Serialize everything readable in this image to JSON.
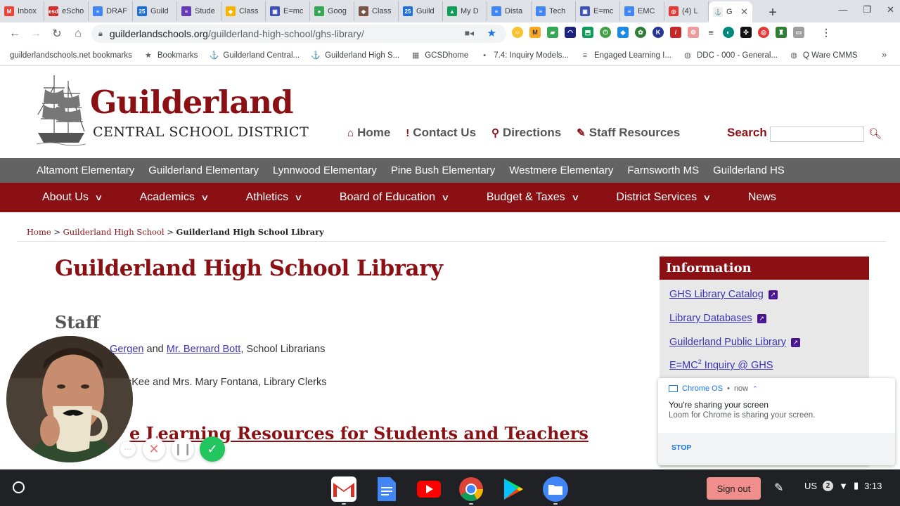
{
  "tabs": [
    {
      "label": "Inbox",
      "fav": "M",
      "color": "#ea4335",
      "icon": "gmail-icon"
    },
    {
      "label": "eScho",
      "fav": "esd",
      "color": "#d32f2f",
      "icon": "eschool-icon"
    },
    {
      "label": "DRAF",
      "fav": "≡",
      "color": "#4285f4",
      "icon": "docs-icon"
    },
    {
      "label": "Guild",
      "fav": "25",
      "color": "#1e6fd9",
      "icon": "calendar-icon"
    },
    {
      "label": "Stude",
      "fav": "≡",
      "color": "#673ab7",
      "icon": "forms-icon"
    },
    {
      "label": "Class",
      "fav": "◆",
      "color": "#f4b400",
      "icon": "classroom-icon"
    },
    {
      "label": "E=mc",
      "fav": "▣",
      "color": "#3f51b5",
      "icon": "site-icon"
    },
    {
      "label": "Goog",
      "fav": "●",
      "color": "#34a853",
      "icon": "hangouts-icon"
    },
    {
      "label": "Class",
      "fav": "◆",
      "color": "#795548",
      "icon": "classroom-icon"
    },
    {
      "label": "Guild",
      "fav": "25",
      "color": "#1e6fd9",
      "icon": "calendar-icon"
    },
    {
      "label": "My D",
      "fav": "▲",
      "color": "#0f9d58",
      "icon": "drive-icon"
    },
    {
      "label": "Dista",
      "fav": "≡",
      "color": "#4285f4",
      "icon": "docs-icon"
    },
    {
      "label": "Tech",
      "fav": "≡",
      "color": "#4285f4",
      "icon": "docs-icon"
    },
    {
      "label": "E=mc",
      "fav": "▣",
      "color": "#3f51b5",
      "icon": "site-icon"
    },
    {
      "label": "EMC",
      "fav": "≡",
      "color": "#4285f4",
      "icon": "docs-icon"
    },
    {
      "label": "(4) L",
      "fav": "◎",
      "color": "#e53935",
      "icon": "loom-icon"
    }
  ],
  "active_tab": {
    "label": "G",
    "icon": "guilderland-icon"
  },
  "address": {
    "host": "guilderlandschools.org",
    "path": "/guilderland-high-school/ghs-library/"
  },
  "bookmarks": [
    {
      "label": "guilderlandschools.net bookmarks",
      "icon": "folder-icon",
      "glyph": ""
    },
    {
      "label": "Bookmarks",
      "icon": "star-icon",
      "glyph": "★"
    },
    {
      "label": "Guilderland Central...",
      "icon": "guilderland-icon",
      "glyph": "⚓"
    },
    {
      "label": "Guilderland High S...",
      "icon": "guilderland-icon",
      "glyph": "⚓"
    },
    {
      "label": "GCSDhome",
      "icon": "grid-icon",
      "glyph": "▦"
    },
    {
      "label": "7.4: Inquiry Models...",
      "icon": "page-icon",
      "glyph": "▪"
    },
    {
      "label": "Engaged Learning I...",
      "icon": "docs-icon",
      "glyph": "≡"
    },
    {
      "label": "DDC - 000 - General...",
      "icon": "globe-icon",
      "glyph": "◍"
    },
    {
      "label": "Q Ware CMMS",
      "icon": "globe-icon",
      "glyph": "◍"
    }
  ],
  "site": {
    "title": "Guilderland",
    "subtitle": "CENTRAL SCHOOL DISTRICT",
    "topnav": [
      {
        "label": "Home",
        "icon": "home-icon",
        "glyph": "⌂"
      },
      {
        "label": "Contact Us",
        "icon": "info-icon",
        "glyph": "!"
      },
      {
        "label": "Directions",
        "icon": "map-pin-icon",
        "glyph": "⚲"
      },
      {
        "label": "Staff Resources",
        "icon": "paperclip-icon",
        "glyph": "✎"
      }
    ],
    "search_label": "Search",
    "schools": [
      "Altamont Elementary",
      "Guilderland Elementary",
      "Lynnwood Elementary",
      "Pine Bush Elementary",
      "Westmere Elementary",
      "Farnsworth MS",
      "Guilderland HS"
    ],
    "mainnav": [
      {
        "label": "About Us",
        "dropdown": true
      },
      {
        "label": "Academics",
        "dropdown": true
      },
      {
        "label": "Athletics",
        "dropdown": true
      },
      {
        "label": "Board of Education",
        "dropdown": true
      },
      {
        "label": "Budget & Taxes",
        "dropdown": true
      },
      {
        "label": "District Services",
        "dropdown": true
      },
      {
        "label": "News",
        "dropdown": false
      }
    ]
  },
  "breadcrumb": {
    "home": "Home",
    "school": "Guilderland High School",
    "current": "Guilderland High School Library"
  },
  "content": {
    "page_title": "Guilderland High School Library",
    "staff_heading": "Staff",
    "staff1_link1": "a Gergen",
    "staff1_and": "and",
    "staff1_link2": "Mr. Bernard Bott",
    "staff1_suffix": ", School Librarians",
    "staff2": "cKee and Mrs. Mary Fontana, Library Clerks",
    "resources_heading": "e Learning Resources for Students and Teachers"
  },
  "sidebar": {
    "heading": "Information",
    "links": [
      {
        "label": "GHS Library Catalog",
        "external": true
      },
      {
        "label": "Library Databases",
        "external": true
      },
      {
        "label": "Guilderland Public Library",
        "external": true
      }
    ],
    "inquiry_prefix": "E=MC",
    "inquiry_sup": "2",
    "inquiry_suffix": " Inquiry @ GHS"
  },
  "notification": {
    "app": "Chrome OS",
    "time": "now",
    "title": "You're sharing your screen",
    "body": "Loom for Chrome is sharing your screen.",
    "action": "STOP"
  },
  "shelf": {
    "signout": "Sign out",
    "locale": "US",
    "badge": "2",
    "time": "3:13"
  },
  "colors": {
    "brand": "#8b1014",
    "link": "#3b33b8",
    "schoolbar": "#636363"
  }
}
